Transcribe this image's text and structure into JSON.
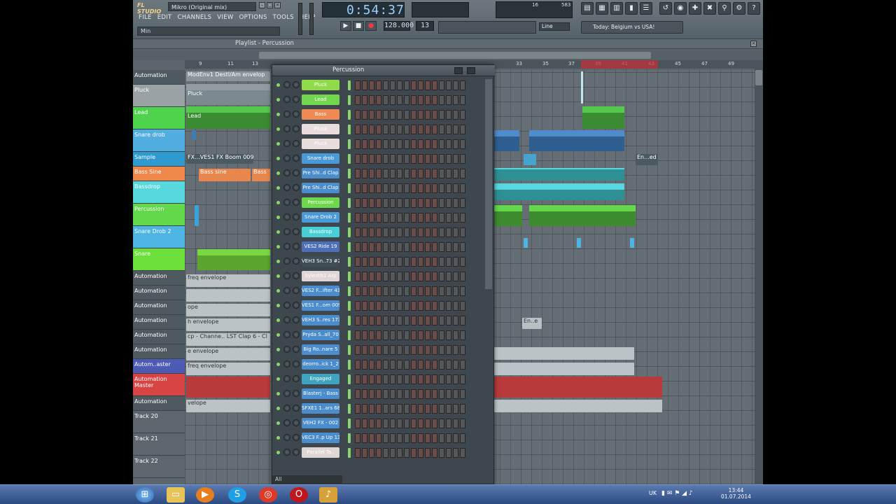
{
  "app": {
    "logo": "FL STUDIO",
    "song_title": "Mikro (Original mix)",
    "hint": "Min",
    "menu": [
      "FILE",
      "EDIT",
      "CHANNELS",
      "VIEW",
      "OPTIONS",
      "TOOLS",
      "HELP"
    ]
  },
  "transport": {
    "time": "0:54:37",
    "bpm": "128.000",
    "pattern": "13",
    "cpu": "16",
    "mem": "583",
    "snap": "Line",
    "play": "▶",
    "stop": "■",
    "record": "●"
  },
  "news": "Today: Belgium vs USA!",
  "playlist": {
    "title": "Playlist - Percussion",
    "ruler": [
      "9",
      "11",
      "13",
      "33",
      "35",
      "37",
      "39",
      "41",
      "43",
      "45",
      "47",
      "49"
    ],
    "tracks": [
      {
        "label": "Automation",
        "color": "#4e5a60"
      },
      {
        "label": "Pluck",
        "color": "#9aa2a6"
      },
      {
        "label": "Lead",
        "color": "#4fd24c"
      },
      {
        "label": "Snare drob",
        "color": "#52aee0"
      },
      {
        "label": "Sample",
        "color": "#2f9ad0"
      },
      {
        "label": "Bass Sine",
        "color": "#f0874a"
      },
      {
        "label": "Bassdrop",
        "color": "#56d8de"
      },
      {
        "label": "Percussion",
        "color": "#62d84a"
      },
      {
        "label": "Snare Drob 2",
        "color": "#4eb5e2"
      },
      {
        "label": "Snare",
        "color": "#6cdf3a"
      },
      {
        "label": "Automation",
        "color": "#4e5a60"
      },
      {
        "label": "Automation",
        "color": "#4e5a60"
      },
      {
        "label": "Automation",
        "color": "#4e5a60"
      },
      {
        "label": "Automation",
        "color": "#4e5a60"
      },
      {
        "label": "Automation",
        "color": "#4e5a60"
      },
      {
        "label": "Automation",
        "color": "#4e5a60"
      },
      {
        "label": "Autom..aster",
        "color": "#4d5bb5"
      },
      {
        "label": "Automation Master",
        "color": "#d84444"
      },
      {
        "label": "Automation",
        "color": "#4e5a60"
      },
      {
        "label": "Track 20",
        "color": "#5c666c"
      },
      {
        "label": "Track 21",
        "color": "#5c666c"
      },
      {
        "label": "Track 22",
        "color": "#5c666c"
      }
    ],
    "clip_labels": {
      "automation1": "ModEnv1 Destl/Am envelop",
      "pluck": "Pluck",
      "pluck2": "Pluck",
      "lead": "Lead",
      "sample": "FX...VES1 FX Boom 009",
      "sample_end": "En...ed",
      "basssine": "Bass sine",
      "basssine2": "Bass",
      "auto_freq": "freq envelope",
      "auto_ope": "ope",
      "auto_h": "h envelope",
      "auto_chan": "cp - Channe.. LST Clap 6 - Cl",
      "auto_e": "e envelope",
      "auto_freq2": "freq envelope",
      "auto_velope": "velope",
      "engaged": "En..e"
    }
  },
  "rack": {
    "title": "Percussion",
    "footer": "All",
    "channels": [
      {
        "name": "Pluck",
        "color": "#8fdc48"
      },
      {
        "name": "Lead",
        "color": "#72d64e"
      },
      {
        "name": "Bass",
        "color": "#ef8a55"
      },
      {
        "name": "Pluck",
        "color": "#e8dcdc"
      },
      {
        "name": "Pluck",
        "color": "#e8dcdc"
      },
      {
        "name": "Snare drob",
        "color": "#4a9ad8"
      },
      {
        "name": "Pre Shi..d Clap",
        "color": "#4a8ccc"
      },
      {
        "name": "Pre Shi..d Clap",
        "color": "#4a8ccc"
      },
      {
        "name": "Percussion",
        "color": "#6cd84a"
      },
      {
        "name": "Snare Drob 2",
        "color": "#4a9ad8"
      },
      {
        "name": "Bassdrop",
        "color": "#48cfd6"
      },
      {
        "name": "VES2 Ride 19",
        "color": "#4e6fb8"
      },
      {
        "name": "VEH3 Sn..73 #2",
        "color": "#3f4d55"
      },
      {
        "name": "Sylenth1 Arp",
        "color": "#e0d6d6"
      },
      {
        "name": "VES2 F...ifter 43",
        "color": "#4a8ccc"
      },
      {
        "name": "VES1 F...om 009",
        "color": "#4a8ccc"
      },
      {
        "name": "VEH3 S..res 173",
        "color": "#4a8ccc"
      },
      {
        "name": "Pryda S..all_70",
        "color": "#4a8ccc"
      },
      {
        "name": "Big Ro..nare 5",
        "color": "#4a8ccc"
      },
      {
        "name": "deorro..ick 1_2",
        "color": "#4a8ccc"
      },
      {
        "name": "Engaged",
        "color": "#3fa4c0"
      },
      {
        "name": "Blasterj - Bass",
        "color": "#4a8ccc"
      },
      {
        "name": "SFXE1 1..ars 68",
        "color": "#4a8ccc"
      },
      {
        "name": "VEH2 FX - 002",
        "color": "#4a8ccc"
      },
      {
        "name": "VEC3 F..p Up 13",
        "color": "#4a8ccc"
      },
      {
        "name": "Parallel Ta..",
        "color": "#e0d6d6"
      }
    ]
  },
  "taskbar": {
    "language": "UK",
    "time": "13:44",
    "date": "01.07.2014"
  }
}
